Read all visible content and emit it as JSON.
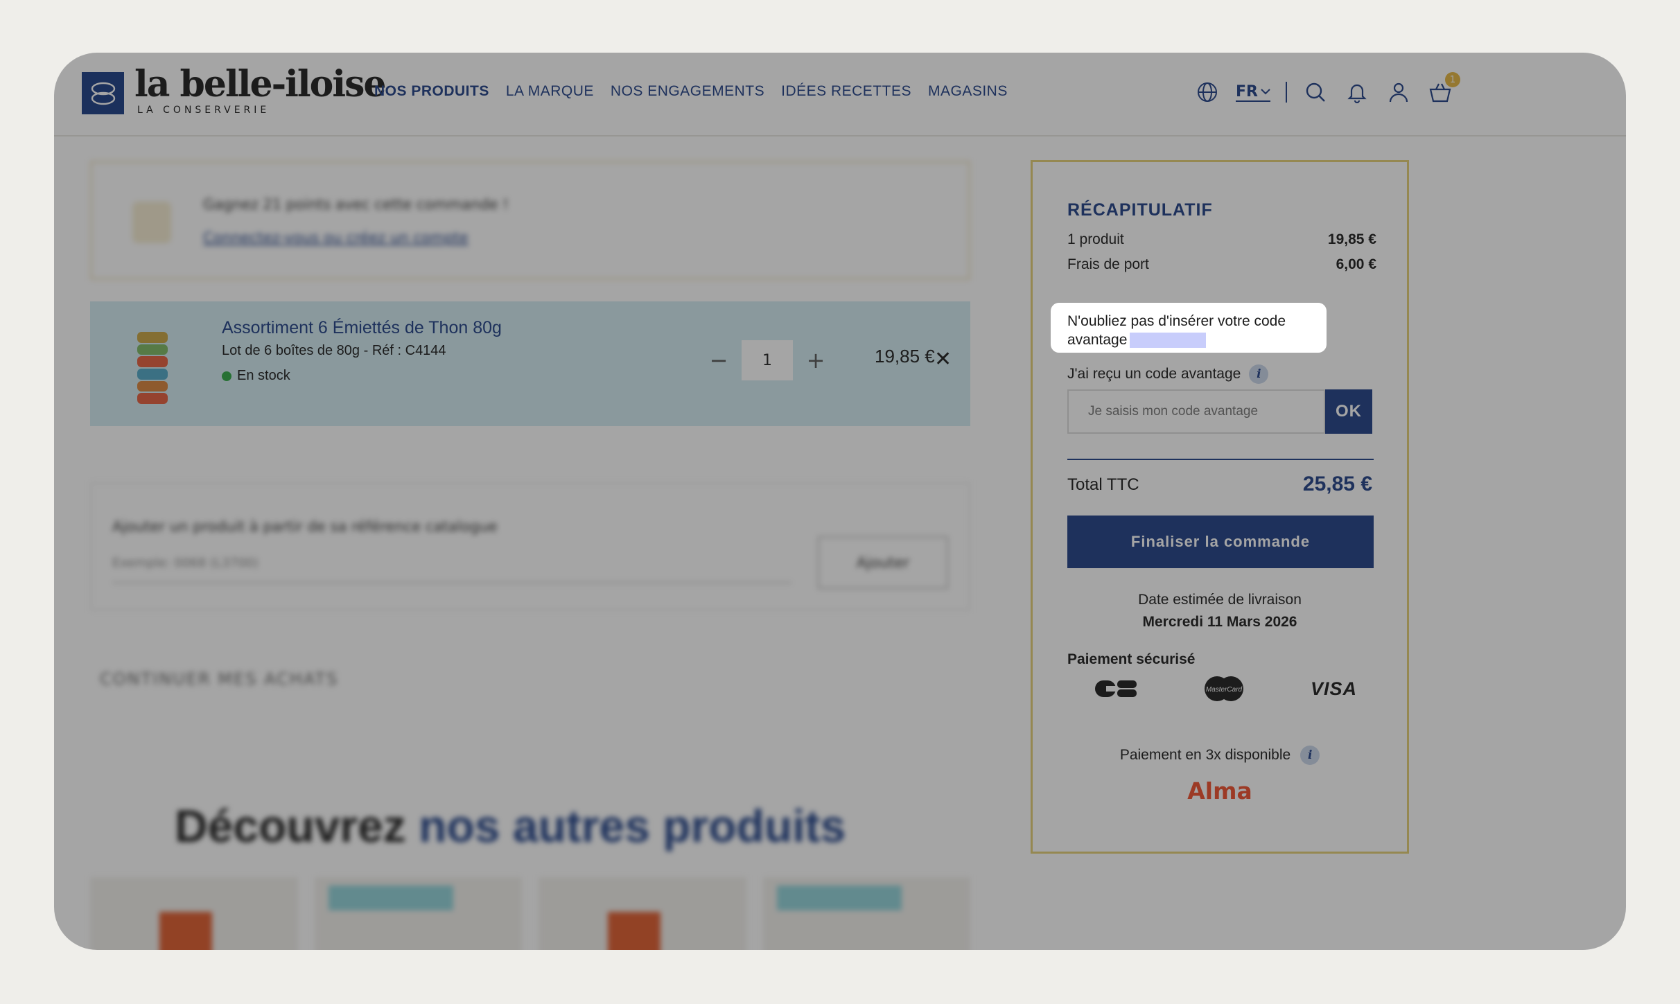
{
  "brand": {
    "name": "la belle-iloise",
    "tagline": "LA CONSERVERIE"
  },
  "nav": {
    "items": [
      {
        "label": "NOS PRODUITS"
      },
      {
        "label": "LA MARQUE"
      },
      {
        "label": "NOS ENGAGEMENTS"
      },
      {
        "label": "IDÉES RECETTES"
      },
      {
        "label": "MAGASINS"
      }
    ]
  },
  "header": {
    "language": "FR",
    "cart_count": "1"
  },
  "loyalty": {
    "line1": "Gagnez 21 points avec cette commande !",
    "line2": "Connectez-vous ou créez un compte"
  },
  "cart_item": {
    "title": "Assortiment 6 Émiettés de Thon 80g",
    "subtitle": "Lot de 6 boîtes de 80g - Réf : C4144",
    "stock": "En stock",
    "quantity": "1",
    "minus": "−",
    "plus": "+",
    "price": "19,85 €",
    "remove": "✕"
  },
  "add_reference": {
    "label": "Ajouter un produit à partir de sa référence catalogue",
    "placeholder": "Exemple: 0068 (L3700)",
    "button": "Ajouter"
  },
  "continue_label": "CONTINUER MES ACHATS",
  "discover": {
    "part1": "Découvrez",
    "part2": "nos autres produits"
  },
  "summary": {
    "title": "RÉCAPITULATIF",
    "rows": [
      {
        "label": "1 produit",
        "value": "19,85 €"
      },
      {
        "label": "Frais de port",
        "value": "6,00 €"
      }
    ],
    "tooltip_line1": "N'oubliez pas d'insérer votre code",
    "tooltip_line2": "avantage",
    "code_label": "J'ai reçu un code avantage",
    "code_placeholder": "Je saisis mon code avantage",
    "ok": "OK",
    "total_label": "Total TTC",
    "total_value": "25,85 €",
    "finalize": "Finaliser la commande",
    "delivery_label": "Date estimée de livraison",
    "delivery_date": "Mercredi 11 Mars 2026",
    "secure_label": "Paiement sécurisé",
    "cards": {
      "visa": "VISA",
      "mastercard": "MasterCard"
    },
    "installments": "Paiement en 3x disponible",
    "alma": "Alma",
    "info": "i"
  },
  "colors": {
    "brand_blue": "#1e3f86",
    "gold_border": "#e5cf73",
    "stock_green": "#2ea844",
    "alma_red": "#f14e2b"
  }
}
